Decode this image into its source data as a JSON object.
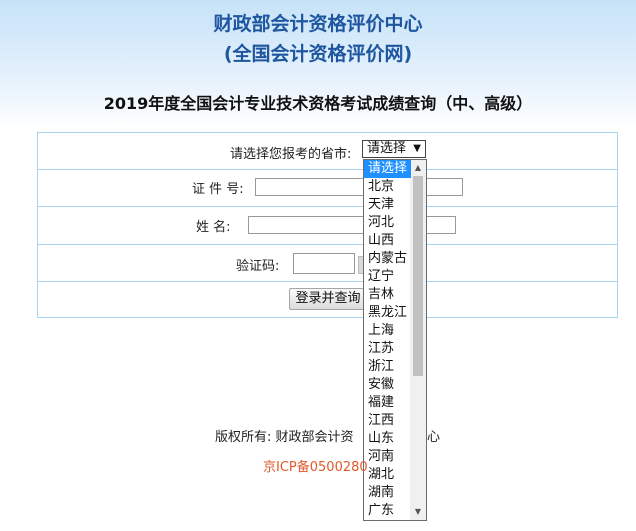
{
  "header": {
    "org_line1": "财政部会计资格评价中心",
    "org_line2": "(全国会计资格评价网)",
    "title": "2019年度全国会计专业技术资格考试成绩查询（中、高级）"
  },
  "form": {
    "province_label": "请选择您报考的省市:",
    "province_selected": "请选择",
    "id_label": "证 件 号:",
    "name_label": "姓    名:",
    "captcha_label": "验证码:",
    "submit_label": "登录并查询"
  },
  "dropdown": {
    "options": [
      "请选择",
      "北京",
      "天津",
      "河北",
      "山西",
      "内蒙古",
      "辽宁",
      "吉林",
      "黑龙江",
      "上海",
      "江苏",
      "浙江",
      "安徽",
      "福建",
      "江西",
      "山东",
      "河南",
      "湖北",
      "湖南",
      "广东"
    ],
    "selected_index": 0
  },
  "footer": {
    "copyright_prefix": "版权所有: 财政部会计资",
    "copyright_tail": "心",
    "icp": "京ICP备0500280"
  },
  "icons": {
    "dropdown_arrow": "chevron-down-icon",
    "scroll_up": "scroll-up-icon",
    "scroll_down": "scroll-down-icon"
  }
}
